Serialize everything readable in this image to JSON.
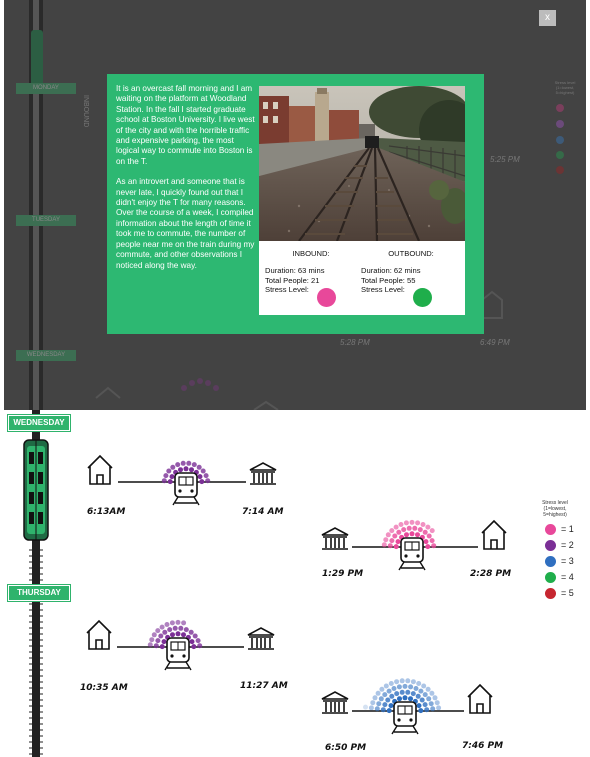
{
  "close_button": {
    "label": "x"
  },
  "modal": {
    "paragraphs": [
      "It is an overcast fall morning and I am waiting on the platform at Woodland Station. In the fall I started graduate school at Boston University. I live west of the city and with the horrible traffic and expensive parking, the most logical way to commute into Boston is on the T.",
      "As an introvert and someone that is never late, I quickly found out that I didn't enjoy the T for many reasons. Over the course of a week, I compiled information about the length of time it took me to commute, the number of people near me on the train during my commute, and other observations I noticed along the way."
    ],
    "inbound": {
      "heading": "INBOUND:",
      "duration": "Duration: 63 mins",
      "people": "Total People: 21",
      "stress_label": "Stress Level:",
      "stress_color": "#e8489a"
    },
    "outbound": {
      "heading": "OUTBOUND:",
      "duration": "Duration: 62 mins",
      "people": "Total People: 55",
      "stress_label": "Stress Level:",
      "stress_color": "#1fae4b"
    }
  },
  "background": {
    "days": [
      "MONDAY",
      "TUESDAY",
      "WEDNESDAY"
    ],
    "rail_label": "INBOUND",
    "times": [
      "5:28 PM",
      "6:49 PM",
      "5:25 PM"
    ],
    "legend_title": "Stress level (1=lowest, 5=highest)"
  },
  "days": {
    "wednesday": "WEDNESDAY",
    "thursday": "THURSDAY"
  },
  "commutes": {
    "wed_in": {
      "depart": "6:13AM",
      "arrive": "7:14 AM",
      "stress": 2,
      "people": 21
    },
    "wed_out": {
      "depart": "1:29 PM",
      "arrive": "2:28 PM",
      "stress": 1,
      "people": 33
    },
    "thu_in": {
      "depart": "10:35 AM",
      "arrive": "11:27 AM",
      "stress": 2,
      "people": 30
    },
    "thu_out": {
      "depart": "6:50 PM",
      "arrive": "7:46 PM",
      "stress": 3,
      "people": 55
    }
  },
  "legend": {
    "title_line1": "Stress level",
    "title_line2": "(1=lowest,",
    "title_line3": "5=highest)",
    "items": [
      {
        "label": "= 1",
        "color": "#e8489a"
      },
      {
        "label": "= 2",
        "color": "#7b2f96"
      },
      {
        "label": "= 3",
        "color": "#2f6fc0"
      },
      {
        "label": "= 4",
        "color": "#1fae4b"
      },
      {
        "label": "= 5",
        "color": "#c62630"
      }
    ]
  }
}
